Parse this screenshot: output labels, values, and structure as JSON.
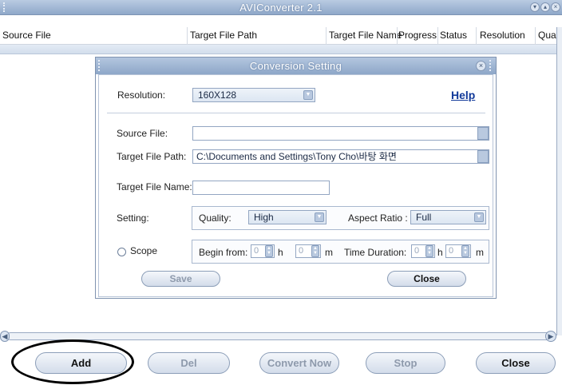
{
  "window": {
    "title": "AVIConverter 2.1"
  },
  "table": {
    "columns": [
      "Source File",
      "Target File Path",
      "Target File Name",
      "Progress",
      "Status",
      "Resolution",
      "Qua"
    ]
  },
  "dialog": {
    "title": "Conversion Setting",
    "resolution_label": "Resolution:",
    "resolution_value": "160X128",
    "help_label": "Help",
    "source_file_label": "Source File:",
    "source_file_value": "",
    "target_path_label": "Target File Path:",
    "target_path_value": "C:\\Documents and Settings\\Tony Cho\\바탕 화면",
    "target_name_label": "Target File Name:",
    "target_name_value": "",
    "setting_label": "Setting:",
    "quality_label": "Quality:",
    "quality_value": "High",
    "aspect_label": "Aspect Ratio :",
    "aspect_value": "Full",
    "scope_label": "Scope",
    "begin_label": "Begin from:",
    "begin_h_value": "0",
    "h_unit": "h",
    "begin_m_value": "0",
    "m_unit": "m",
    "duration_label": "Time Duration:",
    "duration_h_value": "0",
    "duration_m_value": "0",
    "save_label": "Save",
    "close_label": "Close"
  },
  "toolbar": {
    "add_label": "Add",
    "del_label": "Del",
    "convert_label": "Convert Now",
    "stop_label": "Stop",
    "close_label": "Close"
  }
}
